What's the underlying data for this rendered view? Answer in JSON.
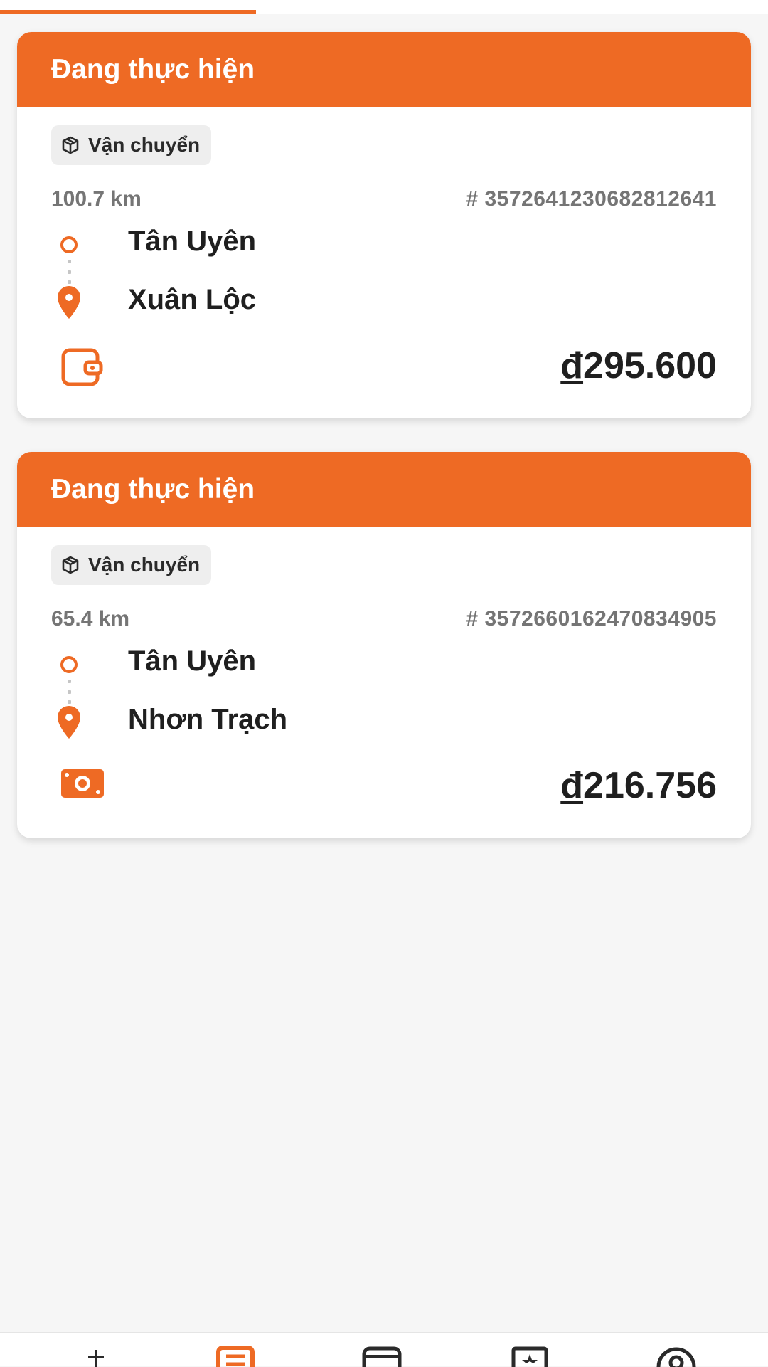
{
  "colors": {
    "accent": "#ee6a24",
    "muted": "#757575",
    "text": "#1f1f1f"
  },
  "orders": [
    {
      "status": "Đang thực hiện",
      "type_label": "Vận chuyển",
      "distance": "100.7 km",
      "order_id": "# 3572641230682812641",
      "origin": "Tân Uyên",
      "destination": "Xuân Lộc",
      "payment_icon": "wallet-icon",
      "currency": "đ",
      "amount": "295.600"
    },
    {
      "status": "Đang thực hiện",
      "type_label": "Vận chuyển",
      "distance": "65.4 km",
      "order_id": "# 3572660162470834905",
      "origin": "Tân Uyên",
      "destination": "Nhơn Trạch",
      "payment_icon": "cash-icon",
      "currency": "đ",
      "amount": "216.756"
    }
  ],
  "bottom_nav": {
    "items": [
      "home-icon",
      "orders-icon",
      "wallet-icon",
      "rewards-icon",
      "profile-icon"
    ],
    "active": "orders-icon"
  }
}
